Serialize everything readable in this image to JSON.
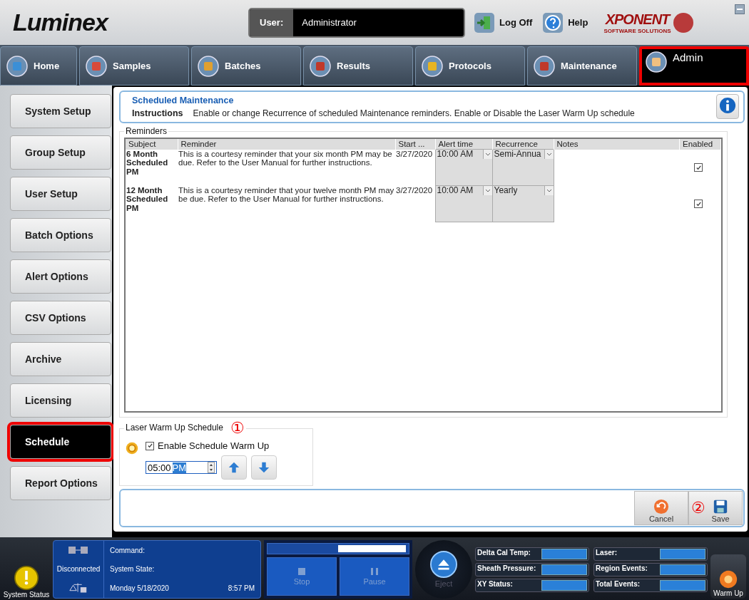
{
  "header": {
    "logo": "Luminex",
    "user_label": "User:",
    "user_value": "Administrator",
    "log_off": "Log Off",
    "help": "Help",
    "brand": "XPONENT",
    "brand_sub": "SOFTWARE SOLUTIONS"
  },
  "nav_tabs": [
    {
      "label": "Home",
      "selected": false,
      "highlighted": false
    },
    {
      "label": "Samples",
      "selected": false,
      "highlighted": false
    },
    {
      "label": "Batches",
      "selected": false,
      "highlighted": false
    },
    {
      "label": "Results",
      "selected": false,
      "highlighted": false
    },
    {
      "label": "Protocols",
      "selected": false,
      "highlighted": false
    },
    {
      "label": "Maintenance",
      "selected": false,
      "highlighted": false
    },
    {
      "label": "Admin",
      "selected": true,
      "highlighted": true
    }
  ],
  "sidebar": {
    "items": [
      {
        "label": "System Setup",
        "selected": false,
        "highlighted": false
      },
      {
        "label": "Group Setup",
        "selected": false,
        "highlighted": false
      },
      {
        "label": "User Setup",
        "selected": false,
        "highlighted": false
      },
      {
        "label": "Batch Options",
        "selected": false,
        "highlighted": false
      },
      {
        "label": "Alert Options",
        "selected": false,
        "highlighted": false
      },
      {
        "label": "CSV Options",
        "selected": false,
        "highlighted": false
      },
      {
        "label": "Archive",
        "selected": false,
        "highlighted": false
      },
      {
        "label": "Licensing",
        "selected": false,
        "highlighted": false
      },
      {
        "label": "Schedule",
        "selected": true,
        "highlighted": true
      },
      {
        "label": "Report Options",
        "selected": false,
        "highlighted": false
      }
    ]
  },
  "info": {
    "title": "Scheduled Maintenance",
    "instructions_label": "Instructions",
    "instructions_text": "Enable or change Recurrence of scheduled Maintenance reminders. Enable  or Disable the Laser Warm Up schedule"
  },
  "reminders": {
    "title": "Reminders",
    "columns": [
      "Subject",
      "Reminder",
      "Start ...",
      "Alert time",
      "Recurrence",
      "Notes",
      "Enabled"
    ],
    "rows": [
      {
        "subject": "6 Month Scheduled PM",
        "reminder": "This is a courtesy reminder that your six month PM may be due. Refer to the User Manual for further instructions.",
        "start": "3/27/2020",
        "alert_time": "10:00 AM",
        "recurrence": "Semi-Annua",
        "enabled": true
      },
      {
        "subject": "12 Month Scheduled PM",
        "reminder": "This is a courtesy reminder that your twelve month PM may be due. Refer to the User Manual for further instructions.",
        "start": "3/27/2020",
        "alert_time": "10:00 AM",
        "recurrence": "Yearly",
        "enabled": true
      }
    ]
  },
  "warm_up": {
    "title": "Laser Warm Up Schedule",
    "marker": "①",
    "enable_label": "Enable Schedule Warm Up",
    "enabled": true,
    "time_value": "05:00",
    "time_period": "PM"
  },
  "actions": {
    "cancel": "Cancel",
    "save": "Save",
    "marker": "②"
  },
  "status_bar": {
    "system_status": "System Status",
    "connection": "Disconnected",
    "command_label": "Command:",
    "state_label": "System State:",
    "date": "Monday 5/18/2020",
    "time": "8:57 PM",
    "progress": {
      "level": 0.5
    },
    "stop": {
      "label": "Stop",
      "disabled": true
    },
    "pause": {
      "label": "Pause",
      "disabled": true
    },
    "eject": {
      "label": "Eject",
      "disabled": true
    },
    "readouts": [
      {
        "label": "Delta Cal Temp:"
      },
      {
        "label": "Laser:"
      },
      {
        "label": "Sheath Pressure:"
      },
      {
        "label": "Region Events:"
      },
      {
        "label": "XY Status:"
      },
      {
        "label": "Total Events:"
      }
    ],
    "warm_up": "Warm Up"
  }
}
